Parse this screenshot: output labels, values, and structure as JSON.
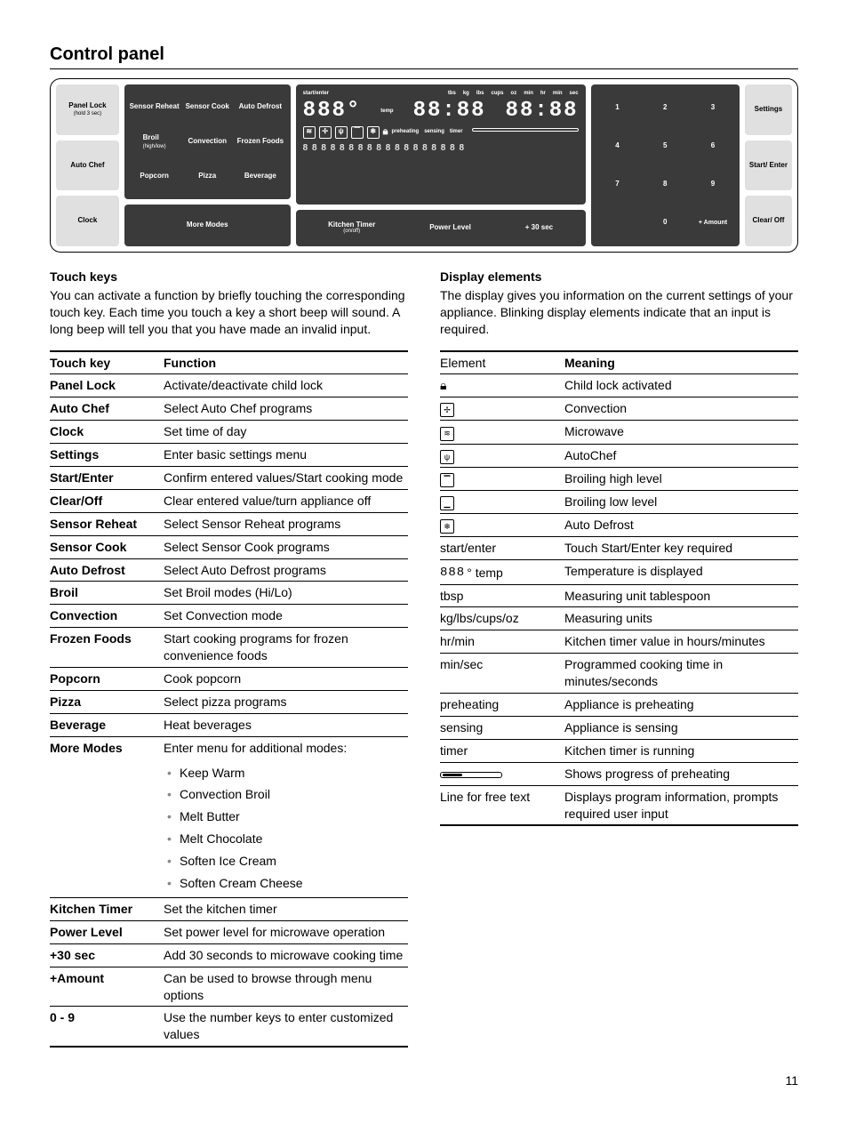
{
  "page": {
    "heading": "Control panel",
    "number": "11"
  },
  "panel": {
    "left_tiles": {
      "panel_lock": "Panel Lock",
      "panel_lock_sub": "(hold 3 sec)",
      "auto_chef": "Auto Chef",
      "clock": "Clock"
    },
    "functions": {
      "r1c1": "Sensor Reheat",
      "r1c2": "Sensor Cook",
      "r1c3": "Auto Defrost",
      "r2c1": "Broil",
      "r2c1_sub": "(high/low)",
      "r2c2": "Convection",
      "r2c3": "Frozen Foods",
      "r3c1": "Popcorn",
      "r3c2": "Pizza",
      "r3c3": "Beverage",
      "more_modes": "More Modes"
    },
    "display": {
      "start_enter_lbl": "start/enter",
      "digits_temp": "888°",
      "temp_lbl": "temp",
      "digits_weight": "88:88",
      "digits_time": "88:88",
      "units": [
        "tbs",
        "kg",
        "lbs",
        "cups",
        "oz",
        "min",
        "hr",
        "min",
        "sec"
      ],
      "status": [
        "preheating",
        "sensing",
        "timer"
      ],
      "dotline": "8 8 8 8 8 8 8 8 8 8 8 8 8 8 8 8 8 8"
    },
    "bottom_bar": {
      "kitchen_timer": "Kitchen Timer",
      "kitchen_timer_sub": "(on/off)",
      "power_level": "Power Level",
      "plus_30": "+ 30 sec"
    },
    "keypad": [
      "1",
      "2",
      "3",
      "4",
      "5",
      "6",
      "7",
      "8",
      "9",
      "",
      "0",
      "+ Amount"
    ],
    "right_tiles": {
      "settings": "Settings",
      "start_enter": "Start/ Enter",
      "clear_off": "Clear/ Off"
    }
  },
  "touch_keys": {
    "heading": "Touch keys",
    "intro": "You can activate a function by briefly touching the corresponding touch key. Each time you touch a key a short beep will sound. A long beep will tell you that you have made an invalid input.",
    "th_key": "Touch key",
    "th_fn": "Function",
    "rows": [
      {
        "k": "Panel Lock",
        "f": "Activate/deactivate child lock"
      },
      {
        "k": "Auto Chef",
        "f": "Select Auto Chef programs"
      },
      {
        "k": "Clock",
        "f": "Set time of day"
      },
      {
        "k": "Settings",
        "f": "Enter basic settings menu"
      },
      {
        "k": "Start/Enter",
        "f": "Confirm entered values/Start cooking mode"
      },
      {
        "k": "Clear/Off",
        "f": "Clear entered value/turn appliance off"
      },
      {
        "k": "Sensor Reheat",
        "f": "Select Sensor Reheat programs"
      },
      {
        "k": "Sensor Cook",
        "f": "Select Sensor Cook programs"
      },
      {
        "k": "Auto Defrost",
        "f": "Select Auto Defrost programs"
      },
      {
        "k": "Broil",
        "f": "Set Broil modes (Hi/Lo)"
      },
      {
        "k": "Convection",
        "f": "Set Convection mode"
      },
      {
        "k": "Frozen Foods",
        "f": "Start cooking programs for frozen convenience foods"
      },
      {
        "k": "Popcorn",
        "f": "Cook popcorn"
      },
      {
        "k": "Pizza",
        "f": "Select pizza programs"
      },
      {
        "k": "Beverage",
        "f": "Heat beverages"
      }
    ],
    "more_modes": {
      "k": "More Modes",
      "f": "Enter menu for additional modes:",
      "items": [
        "Keep Warm",
        "Convection Broil",
        "Melt Butter",
        "Melt Chocolate",
        "Soften Ice Cream",
        "Soften Cream Cheese"
      ]
    },
    "rows2": [
      {
        "k": "Kitchen Timer",
        "f": "Set the kitchen timer"
      },
      {
        "k": "Power Level",
        "f": "Set power level for microwave operation"
      },
      {
        "k": "+30 sec",
        "f": "Add 30 seconds to microwave cooking time"
      },
      {
        "k": "+Amount",
        "f": "Can be used to browse through menu options"
      },
      {
        "k": "0 - 9",
        "f": "Use the number keys to enter customized values"
      }
    ]
  },
  "display_elements": {
    "heading": "Display elements",
    "intro": "The display gives you information on the current settings of your appliance. Blinking display elements indicate that an input is required.",
    "th_el": "Element",
    "th_mn": "Meaning",
    "rows": [
      {
        "icon": "lock",
        "label": "",
        "m": "Child lock activated"
      },
      {
        "icon": "conv",
        "label": "",
        "m": "Convection"
      },
      {
        "icon": "micro",
        "label": "",
        "m": "Microwave"
      },
      {
        "icon": "chef",
        "label": "",
        "m": "AutoChef"
      },
      {
        "icon": "broil-hi",
        "label": "",
        "m": "Broiling high level"
      },
      {
        "icon": "broil-lo",
        "label": "",
        "m": "Broiling low level"
      },
      {
        "icon": "defrost",
        "label": "",
        "m": "Auto Defrost"
      },
      {
        "icon": "",
        "label": "start/enter",
        "m": "Touch Start/Enter key required"
      },
      {
        "icon": "digits",
        "label": "° temp",
        "m": "Temperature is displayed"
      },
      {
        "icon": "",
        "label": "tbsp",
        "m": "Measuring unit tablespoon"
      },
      {
        "icon": "",
        "label": "kg/lbs/cups/oz",
        "m": "Measuring units"
      },
      {
        "icon": "",
        "label": "hr/min",
        "m": "Kitchen timer value in hours/minutes"
      },
      {
        "icon": "",
        "label": "min/sec",
        "m": "Programmed cooking time in minutes/seconds"
      },
      {
        "icon": "",
        "label": "preheating",
        "m": "Appliance is preheating"
      },
      {
        "icon": "",
        "label": "sensing",
        "m": "Appliance is sensing"
      },
      {
        "icon": "",
        "label": "timer",
        "m": "Kitchen timer is running"
      },
      {
        "icon": "progress",
        "label": "",
        "m": "Shows progress of preheating"
      },
      {
        "icon": "",
        "label": "Line for free text",
        "m": "Displays program information, prompts required user input"
      }
    ]
  }
}
